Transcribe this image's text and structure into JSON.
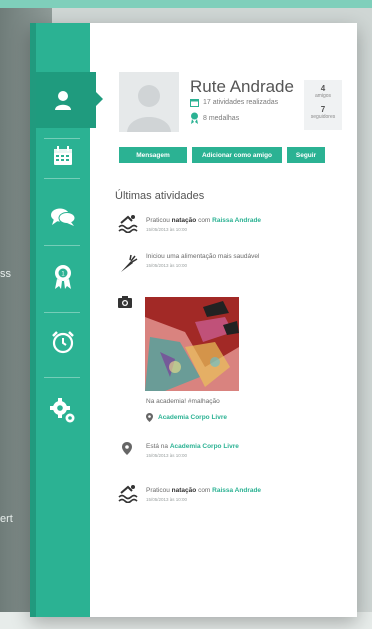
{
  "background": {
    "left_fragments": [
      "ss",
      "ert"
    ]
  },
  "sidebar": {
    "items": [
      {
        "icon": "user-icon"
      },
      {
        "icon": "calendar-icon"
      },
      {
        "icon": "chat-icon"
      },
      {
        "icon": "medal-icon"
      },
      {
        "icon": "alarm-clock-icon"
      },
      {
        "icon": "settings-icon"
      }
    ],
    "active_index": 0
  },
  "profile": {
    "name": "Rute Andrade",
    "activities": "17 atividades realizadas",
    "medals": "8 medalhas",
    "friends_count": "4",
    "friends_label": "amigos",
    "followers_count": "7",
    "followers_label": "seguidores"
  },
  "actions": {
    "message": "Mensagem",
    "add_friend": "Adicionar como amigo",
    "follow": "Seguir"
  },
  "feed": {
    "title": "Últimas atividades",
    "items": [
      {
        "icon": "swimming-icon",
        "prefix": "Praticou",
        "bold": "natação",
        "mid": "com",
        "link": "Raissa Andrade",
        "time": "15/05/2013 às 10:00"
      },
      {
        "icon": "carrot-icon",
        "prefix": "Iniciou uma alimentação mais saudável",
        "time": "15/05/2013 às 10:00"
      },
      {
        "icon": "camera-icon",
        "caption": "Na academia! #malhação",
        "place": "Academia Corpo Livre"
      },
      {
        "icon": "location-pin-icon",
        "prefix": "Está na",
        "link": "Academia Corpo Livre",
        "time": "15/05/2013 às 10:00"
      },
      {
        "icon": "swimming-icon",
        "prefix": "Praticou",
        "bold": "natação",
        "mid": "com",
        "link": "Raissa Andrade",
        "time": "15/05/2013 às 10:00"
      }
    ]
  },
  "colors": {
    "accent": "#2bb293",
    "accent_dark": "#1f9b7e"
  }
}
